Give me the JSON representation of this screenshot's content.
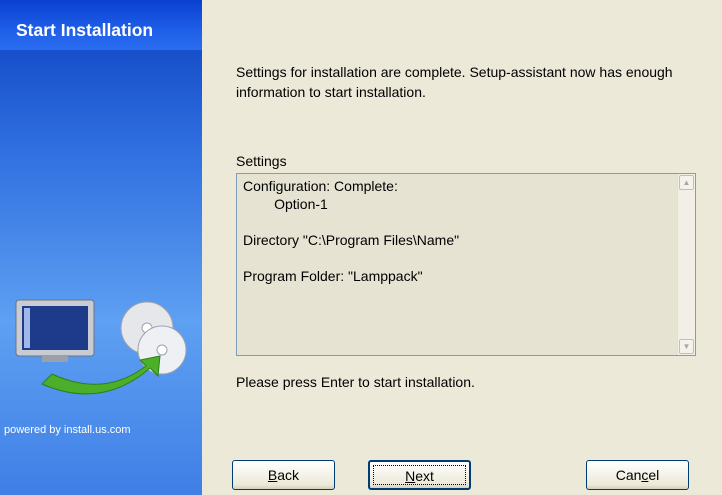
{
  "window": {
    "title": "Start Installation"
  },
  "sidebar": {
    "powered_by": "powered by install.us.com",
    "artwork_icon": "computer-with-discs-icon"
  },
  "main": {
    "intro": "Settings for installation are complete. Setup-assistant now has enough information to start installation.",
    "settings_label": "Settings",
    "settings_text": "Configuration: Complete:\n        Option-1\n\nDirectory \"C:\\Program Files\\Name\"\n\nProgram Folder: \"Lamppack\"",
    "prompt": "Please press Enter to start installation."
  },
  "buttons": {
    "back": {
      "pre": "",
      "key": "B",
      "post": "ack"
    },
    "next": {
      "pre": "",
      "key": "N",
      "post": "ext"
    },
    "cancel": {
      "pre": "Can",
      "key": "c",
      "post": "el"
    }
  }
}
